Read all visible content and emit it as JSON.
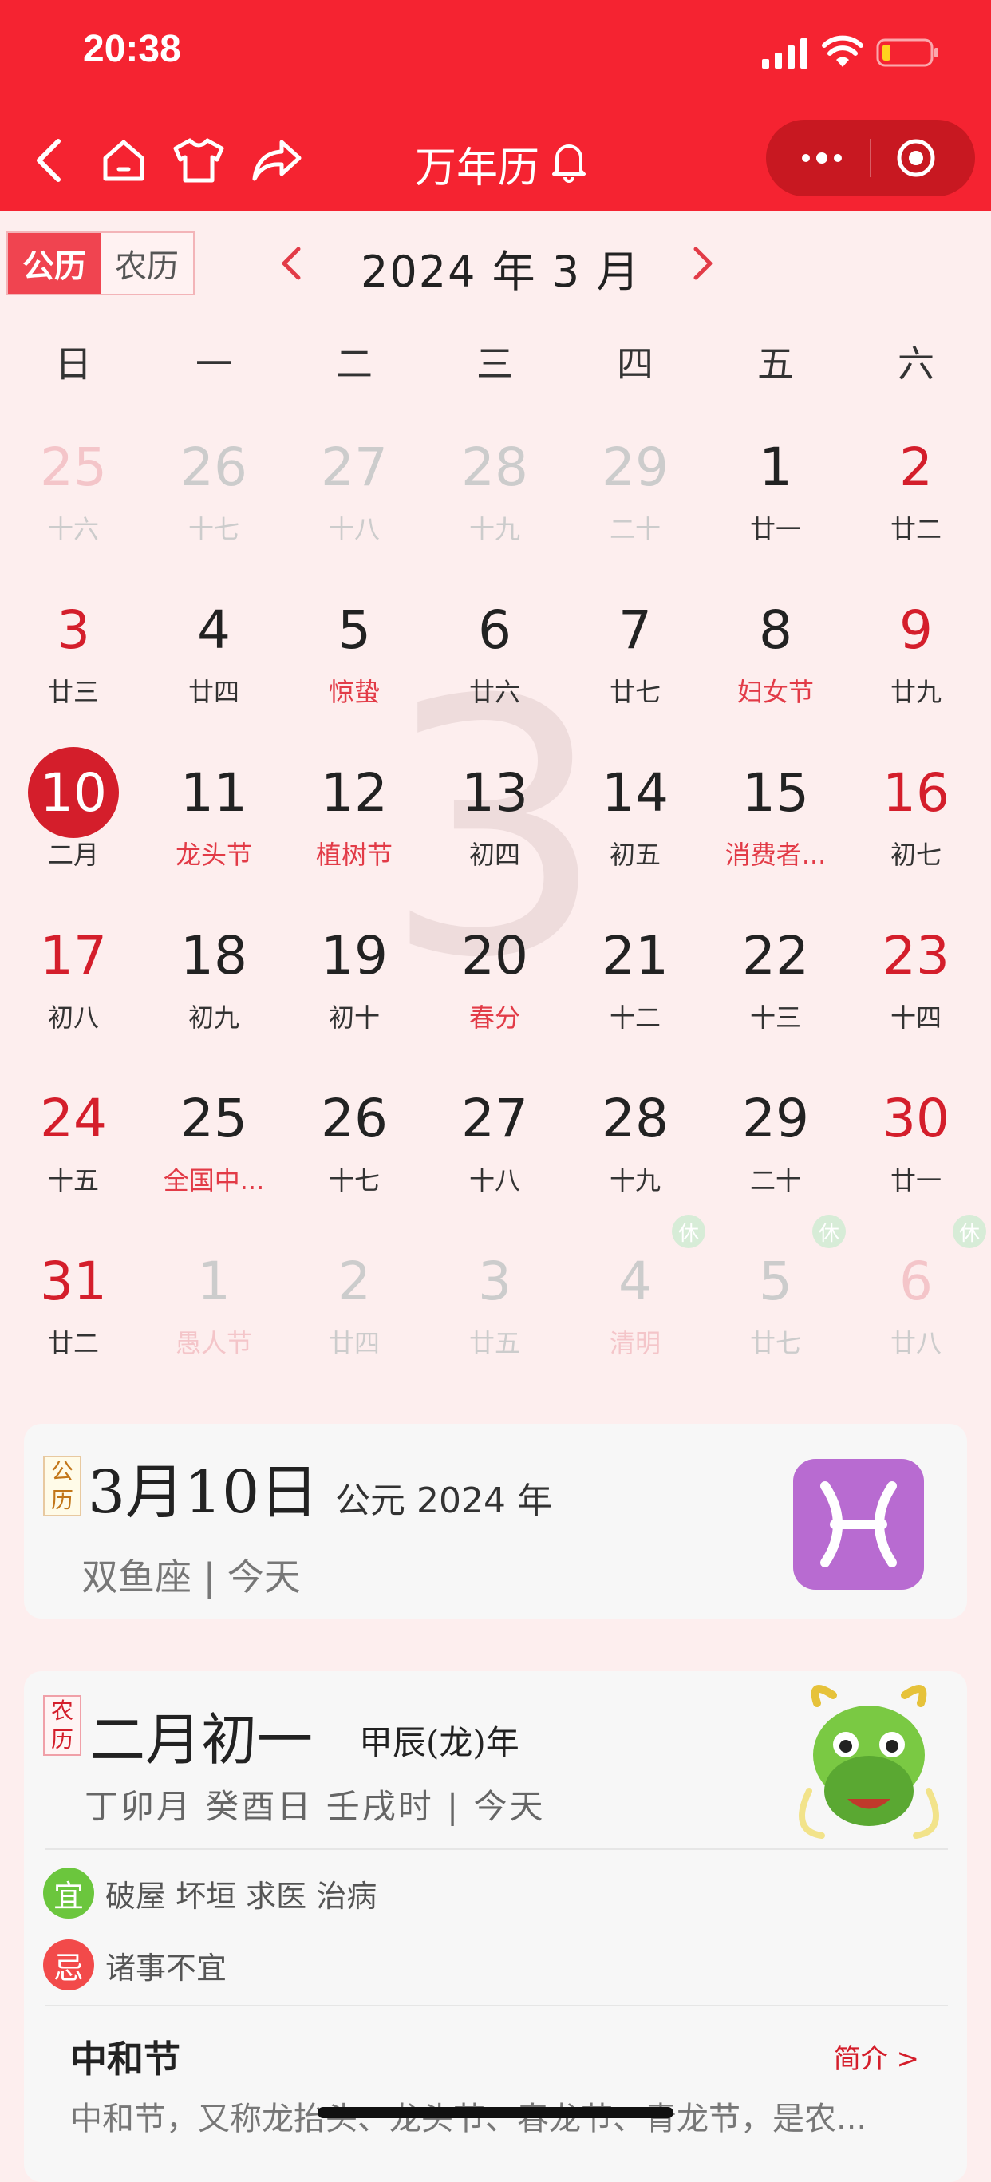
{
  "status": {
    "time": "20:38"
  },
  "nav": {
    "title": "万年历"
  },
  "tabs": {
    "solar": "公历",
    "lunar": "农历"
  },
  "month_label": "2024 年 3 月",
  "weekdays": [
    "日",
    "一",
    "二",
    "三",
    "四",
    "五",
    "六"
  ],
  "watermark": "3",
  "rest_mark": "休",
  "days": [
    [
      {
        "d": "25",
        "s": "十六"
      },
      {
        "d": "26",
        "s": "十七"
      },
      {
        "d": "27",
        "s": "十八"
      },
      {
        "d": "28",
        "s": "十九"
      },
      {
        "d": "29",
        "s": "二十"
      },
      {
        "d": "1",
        "s": "廿一"
      },
      {
        "d": "2",
        "s": "廿二"
      }
    ],
    [
      {
        "d": "3",
        "s": "廿三"
      },
      {
        "d": "4",
        "s": "廿四"
      },
      {
        "d": "5",
        "s": "惊蛰"
      },
      {
        "d": "6",
        "s": "廿六"
      },
      {
        "d": "7",
        "s": "廿七"
      },
      {
        "d": "8",
        "s": "妇女节"
      },
      {
        "d": "9",
        "s": "廿九"
      }
    ],
    [
      {
        "d": "10",
        "s": "二月"
      },
      {
        "d": "11",
        "s": "龙头节"
      },
      {
        "d": "12",
        "s": "植树节"
      },
      {
        "d": "13",
        "s": "初四"
      },
      {
        "d": "14",
        "s": "初五"
      },
      {
        "d": "15",
        "s": "消费者..."
      },
      {
        "d": "16",
        "s": "初七"
      }
    ],
    [
      {
        "d": "17",
        "s": "初八"
      },
      {
        "d": "18",
        "s": "初九"
      },
      {
        "d": "19",
        "s": "初十"
      },
      {
        "d": "20",
        "s": "春分"
      },
      {
        "d": "21",
        "s": "十二"
      },
      {
        "d": "22",
        "s": "十三"
      },
      {
        "d": "23",
        "s": "十四"
      }
    ],
    [
      {
        "d": "24",
        "s": "十五"
      },
      {
        "d": "25",
        "s": "全国中..."
      },
      {
        "d": "26",
        "s": "十七"
      },
      {
        "d": "27",
        "s": "十八"
      },
      {
        "d": "28",
        "s": "十九"
      },
      {
        "d": "29",
        "s": "二十"
      },
      {
        "d": "30",
        "s": "廿一"
      }
    ],
    [
      {
        "d": "31",
        "s": "廿二"
      },
      {
        "d": "1",
        "s": "愚人节"
      },
      {
        "d": "2",
        "s": "廿四"
      },
      {
        "d": "3",
        "s": "廿五"
      },
      {
        "d": "4",
        "s": "清明"
      },
      {
        "d": "5",
        "s": "廿七"
      },
      {
        "d": "6",
        "s": "廿八"
      }
    ]
  ],
  "solar_card": {
    "badge": "公历",
    "date": "3月10日",
    "year": "公元 2024 年",
    "sub": "双鱼座 | 今天"
  },
  "lunar_card": {
    "badge": "农历",
    "date": "二月初一",
    "year": "甲辰(龙)年",
    "ganzhi": "丁卯月 癸酉日 壬戌时 | 今天",
    "yi_label": "宜",
    "yi": "破屋 坏垣 求医 治病",
    "ji_label": "忌",
    "ji": "诸事不宜",
    "festival": "中和节",
    "intro": "简介 >",
    "desc": "中和节，又称龙抬头、龙头节、春龙节、青龙节，是农..."
  },
  "colors": {
    "brand": "#f52331",
    "accent": "#d41e2b",
    "yi": "#6bc63d",
    "ji": "#f24a4a"
  }
}
